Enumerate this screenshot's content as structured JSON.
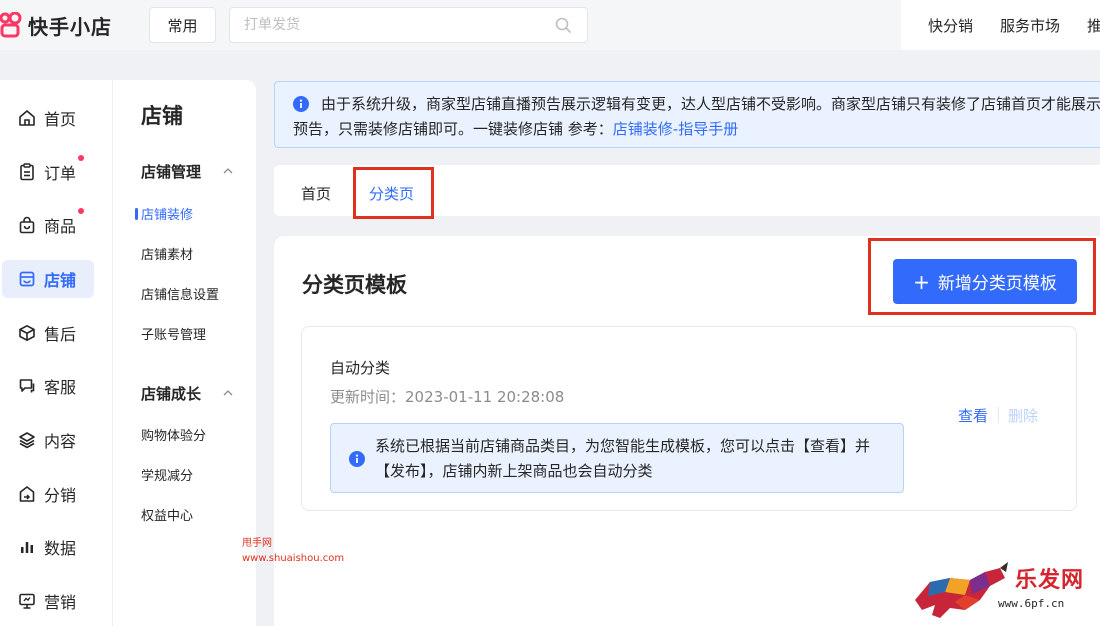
{
  "app": {
    "logo_text": "快手小店"
  },
  "topbar": {
    "common_button": "常用",
    "search_placeholder": "打单发货",
    "nav": [
      "快分销",
      "服务市场",
      "推"
    ]
  },
  "sidebar": {
    "items": [
      {
        "label": "首页",
        "icon": "home-icon",
        "badge": false
      },
      {
        "label": "订单",
        "icon": "order-icon",
        "badge": true
      },
      {
        "label": "商品",
        "icon": "product-bag-icon",
        "badge": true
      },
      {
        "label": "店铺",
        "icon": "store-icon",
        "badge": false,
        "active": true
      },
      {
        "label": "售后",
        "icon": "box-icon",
        "badge": false
      },
      {
        "label": "客服",
        "icon": "chat-icon",
        "badge": false
      },
      {
        "label": "内容",
        "icon": "layers-icon",
        "badge": false
      },
      {
        "label": "分销",
        "icon": "share-icon",
        "badge": false
      },
      {
        "label": "数据",
        "icon": "bar-chart-icon",
        "badge": false
      },
      {
        "label": "营销",
        "icon": "monitor-icon",
        "badge": false
      }
    ]
  },
  "subnav": {
    "title": "店铺",
    "groups": [
      {
        "title": "店铺管理",
        "items": [
          "店铺装修",
          "店铺素材",
          "店铺信息设置",
          "子账号管理"
        ]
      },
      {
        "title": "店铺成长",
        "items": [
          "购物体验分",
          "学规减分",
          "权益中心"
        ]
      }
    ],
    "active_item": "店铺装修"
  },
  "notice": {
    "text": "由于系统升级，商家型店铺直播预告展示逻辑有变更，达人型店铺不受影响。商家型店铺只有装修了店铺首页才能展示直播预告，只需装修店铺即可。一键装修店铺 参考：",
    "link": "店铺装修-指导手册"
  },
  "tabs": [
    {
      "label": "首页",
      "active": false
    },
    {
      "label": "分类页",
      "active": true
    }
  ],
  "main": {
    "title": "分类页模板",
    "add_button": "新增分类页模板",
    "template": {
      "name": "自动分类",
      "updated_label": "更新时间：",
      "updated_value": "2023-01-11 20:28:08",
      "tip": "系统已根据当前店铺商品类目，为您智能生成模板，您可以点击【查看】并【发布】，店铺内新上架商品也会自动分类",
      "view": "查看",
      "delete": "删除"
    }
  },
  "watermarks": {
    "left_line1": "甩手网",
    "left_line2": "www.shuaishou.com",
    "right_title": "乐发网",
    "right_url": "www.6pf.cn"
  },
  "colors": {
    "primary": "#326bfb",
    "highlight_box": "#e0301e",
    "badge": "#fe3666",
    "logo": "#fe3666",
    "notice_bg": "#e9f2fe"
  }
}
